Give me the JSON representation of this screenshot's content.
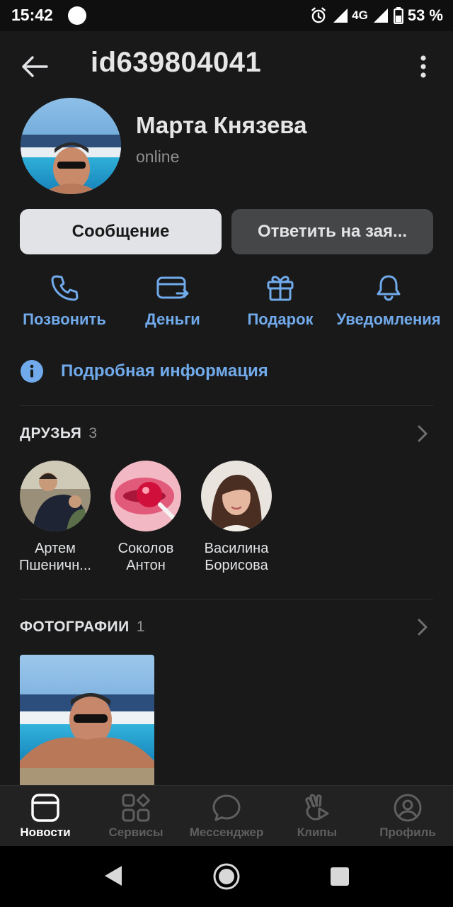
{
  "status_bar": {
    "time": "15:42",
    "network": "4G",
    "battery": "53 %",
    "icons": [
      "circle-notification-icon",
      "alarm-icon",
      "signal-icon",
      "battery-icon"
    ]
  },
  "header": {
    "title": "id639804041",
    "icons": [
      "back-arrow-icon",
      "more-vertical-icon"
    ]
  },
  "profile": {
    "name": "Марта Князева",
    "status": "online"
  },
  "buttons": {
    "message": "Сообщение",
    "reply_request": "Ответить на зая..."
  },
  "actions": [
    {
      "label": "Позвонить",
      "icon": "phone-icon"
    },
    {
      "label": "Деньги",
      "icon": "money-transfer-icon"
    },
    {
      "label": "Подарок",
      "icon": "gift-icon"
    },
    {
      "label": "Уведомления",
      "icon": "bell-icon"
    }
  ],
  "details": {
    "label": "Подробная информация",
    "icon": "info-icon"
  },
  "friends": {
    "title": "ДРУЗЬЯ",
    "count": "3",
    "items": [
      {
        "line1": "Артем",
        "line2": "Пшеничн..."
      },
      {
        "line1": "Соколов",
        "line2": "Антон"
      },
      {
        "line1": "Василина",
        "line2": "Борисова"
      }
    ]
  },
  "photos": {
    "title": "ФОТОГРАФИИ",
    "count": "1"
  },
  "tabbar": [
    {
      "label": "Новости",
      "icon": "news-icon",
      "active": true
    },
    {
      "label": "Сервисы",
      "icon": "services-icon",
      "active": false
    },
    {
      "label": "Мессенджер",
      "icon": "messenger-icon",
      "active": false
    },
    {
      "label": "Клипы",
      "icon": "clips-icon",
      "active": false
    },
    {
      "label": "Профиль",
      "icon": "profile-icon",
      "active": false
    }
  ],
  "colors": {
    "background": "#191919",
    "accent": "#71aaeb",
    "primary_button": "#e1e3e6",
    "secondary_button": "#454647",
    "muted_text": "#8f8f8f"
  }
}
